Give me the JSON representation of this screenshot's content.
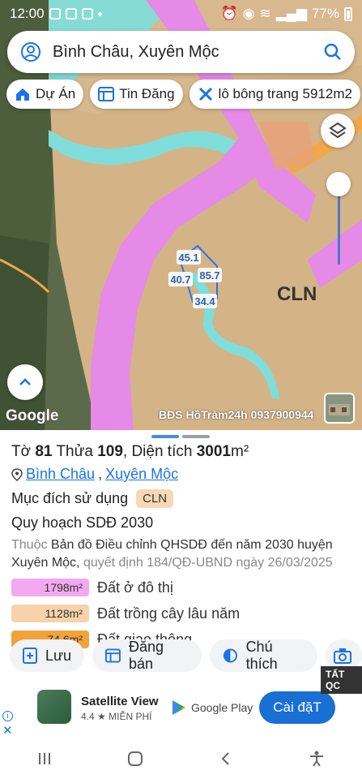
{
  "status_bar": {
    "time": "12:00",
    "battery": "77%"
  },
  "search": {
    "query": "Bình Châu, Xuyên Mộc"
  },
  "chips": [
    {
      "label": "Dự Án"
    },
    {
      "label": "Tin Đăng"
    },
    {
      "label": "lô bông trang 5912m2"
    }
  ],
  "map": {
    "zone_label": "CLN",
    "measurements": [
      "45.1",
      "40.7",
      "85.7",
      "34.4"
    ],
    "google": "Google",
    "watermark": "BĐS HồTràm24h 0937900944",
    "colors": {
      "residential": "#e58ae6",
      "perennial": "#eac99b",
      "water": "#7fdedb",
      "road": "#f0a848"
    }
  },
  "parcel": {
    "sheet_label": "Tờ",
    "sheet": "81",
    "plot_label": "Thửa",
    "plot": "109",
    "area_label": "Diện tích",
    "area": "3001",
    "area_unit": "m²",
    "commune": "Bình Châu",
    "district": "Xuyên Mộc",
    "comma": ",",
    "separator": ",",
    "purpose_label": "Mục đích sử dụng",
    "purpose_code": "CLN",
    "plan_label": "Quy hoạch SDĐ 2030",
    "plan_desc_prefix": "Thuộc",
    "plan_desc": "Bản đồ Điều chỉnh QHSDĐ đến năm 2030 huyện Xuyên Mộc,",
    "plan_decision": "quyết định 184/QĐ-UBND ngày 26/03/2025"
  },
  "legend": [
    {
      "value": "1798m²",
      "label": "Đất ở đô thị",
      "color": "#f3a9f0"
    },
    {
      "value": "1128m²",
      "label": "Đất trồng cây lâu năm",
      "color": "#f6d3ab"
    },
    {
      "value": "74.6m²",
      "label": "Đất giao thông",
      "color": "#f2a23a"
    }
  ],
  "actions": [
    {
      "label": "Lưu"
    },
    {
      "label": "Đăng bán"
    },
    {
      "label": "Chú thích"
    }
  ],
  "ad": {
    "label": "TẤT QC",
    "app_name": "Satellite View",
    "rating": "4.4 ★",
    "price": "MIỄN PHÍ",
    "store": "Google Play",
    "install": "Cài đặT"
  }
}
